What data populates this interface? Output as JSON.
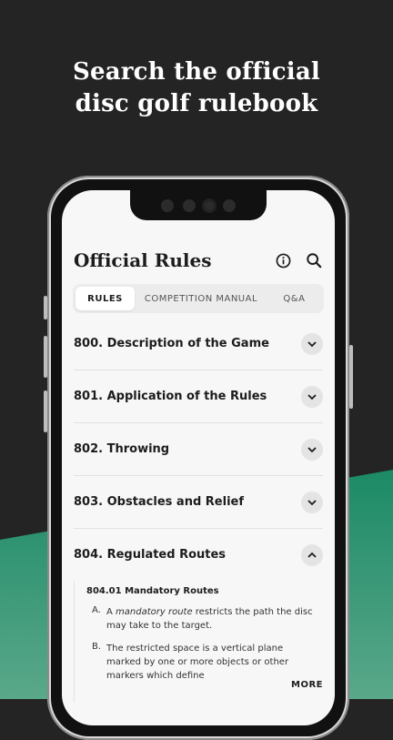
{
  "headline": [
    "Search the official",
    "disc golf rulebook"
  ],
  "app": {
    "title": "Official Rules"
  },
  "tabs": [
    {
      "label": "RULES",
      "active": true
    },
    {
      "label": "COMPETITION MANUAL",
      "active": false
    },
    {
      "label": "Q&A",
      "active": false
    }
  ],
  "rules": [
    {
      "title": "800. Description of the Game",
      "expanded": false
    },
    {
      "title": "801. Application of the Rules",
      "expanded": false
    },
    {
      "title": "802. Throwing",
      "expanded": false
    },
    {
      "title": "803. Obstacles and Relief",
      "expanded": false
    },
    {
      "title": "804. Regulated Routes",
      "expanded": true
    }
  ],
  "expanded_section": {
    "title": "804.01 Mandatory Routes",
    "items": [
      {
        "letter": "A.",
        "prefix": "A ",
        "emphasis": "mandatory route",
        "text": " restricts the path the disc may take to the target."
      },
      {
        "letter": "B.",
        "prefix": "",
        "emphasis": "",
        "text": "The restricted space is a vertical plane marked by one or more objects or other markers which define"
      }
    ],
    "more_label": "MORE"
  },
  "colors": {
    "background_dark": "#242424",
    "background_green": "#1f8a67",
    "screen": "#f7f7f7",
    "text": "#1c1c1c"
  },
  "icons": {
    "info": "info-icon",
    "search": "search-icon",
    "chevron_down": "chevron-down-icon",
    "chevron_up": "chevron-up-icon"
  }
}
